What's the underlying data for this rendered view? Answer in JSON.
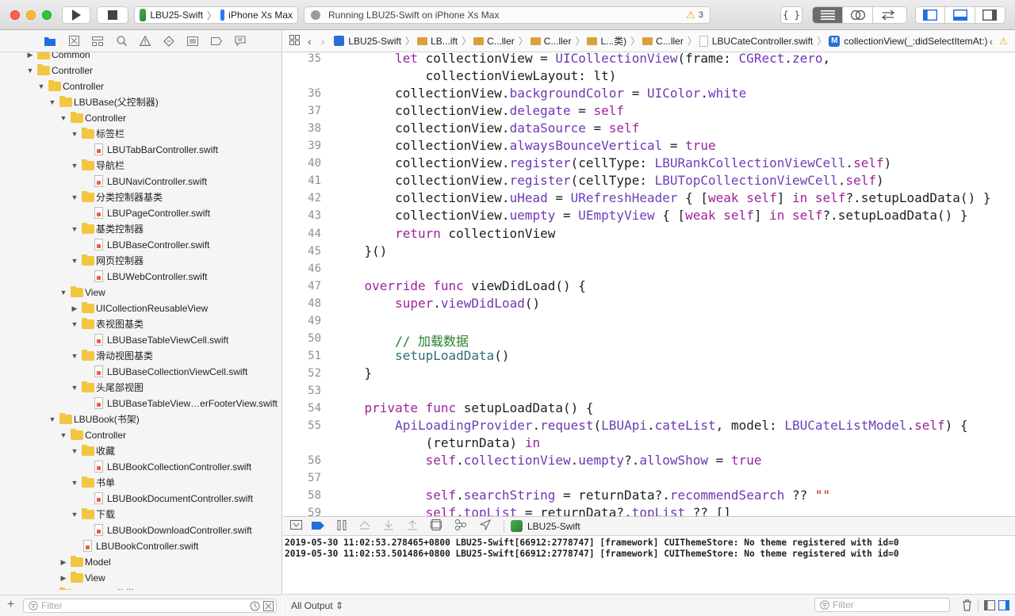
{
  "toolbar": {
    "scheme_target": "LBU25-Swift",
    "scheme_device": "iPhone Xs Max",
    "status_text": "Running LBU25-Swift on iPhone Xs Max",
    "warning_count": "3"
  },
  "navigator": {
    "items": [
      {
        "depth": 2,
        "type": "folder",
        "open": false,
        "label": "Common"
      },
      {
        "depth": 2,
        "type": "folder",
        "open": true,
        "label": "Controller"
      },
      {
        "depth": 3,
        "type": "folder",
        "open": true,
        "label": "Controller"
      },
      {
        "depth": 4,
        "type": "folder",
        "open": true,
        "label": "LBUBase(父控制器)"
      },
      {
        "depth": 5,
        "type": "folder",
        "open": true,
        "label": "Controller"
      },
      {
        "depth": 6,
        "type": "folder",
        "open": true,
        "label": "标签栏"
      },
      {
        "depth": 7,
        "type": "file",
        "label": "LBUTabBarController.swift"
      },
      {
        "depth": 6,
        "type": "folder",
        "open": true,
        "label": "导航栏"
      },
      {
        "depth": 7,
        "type": "file",
        "label": "LBUNaviController.swift"
      },
      {
        "depth": 6,
        "type": "folder",
        "open": true,
        "label": "分类控制器基类"
      },
      {
        "depth": 7,
        "type": "file",
        "label": "LBUPageController.swift"
      },
      {
        "depth": 6,
        "type": "folder",
        "open": true,
        "label": "基类控制器"
      },
      {
        "depth": 7,
        "type": "file",
        "label": "LBUBaseController.swift"
      },
      {
        "depth": 6,
        "type": "folder",
        "open": true,
        "label": "网页控制器"
      },
      {
        "depth": 7,
        "type": "file",
        "label": "LBUWebController.swift"
      },
      {
        "depth": 5,
        "type": "folder",
        "open": true,
        "label": "View"
      },
      {
        "depth": 6,
        "type": "folder",
        "open": false,
        "label": "UICollectionReusableView"
      },
      {
        "depth": 6,
        "type": "folder",
        "open": true,
        "label": "表视图基类"
      },
      {
        "depth": 7,
        "type": "file",
        "label": "LBUBaseTableViewCell.swift"
      },
      {
        "depth": 6,
        "type": "folder",
        "open": true,
        "label": "滑动视图基类"
      },
      {
        "depth": 7,
        "type": "file",
        "label": "LBUBaseCollectionViewCell.swift"
      },
      {
        "depth": 6,
        "type": "folder",
        "open": true,
        "label": "头尾部视图"
      },
      {
        "depth": 7,
        "type": "file",
        "label": "LBUBaseTableView…erFooterView.swift"
      },
      {
        "depth": 4,
        "type": "folder",
        "open": true,
        "label": "LBUBook(书架)"
      },
      {
        "depth": 5,
        "type": "folder",
        "open": true,
        "label": "Controller"
      },
      {
        "depth": 6,
        "type": "folder",
        "open": true,
        "label": "收藏"
      },
      {
        "depth": 7,
        "type": "file",
        "label": "LBUBookCollectionController.swift"
      },
      {
        "depth": 6,
        "type": "folder",
        "open": true,
        "label": "书单"
      },
      {
        "depth": 7,
        "type": "file",
        "label": "LBUBookDocumentController.swift"
      },
      {
        "depth": 6,
        "type": "folder",
        "open": true,
        "label": "下载"
      },
      {
        "depth": 7,
        "type": "file",
        "label": "LBUBookDownloadController.swift"
      },
      {
        "depth": 6,
        "type": "file",
        "label": "LBUBookController.swift"
      },
      {
        "depth": 5,
        "type": "folder",
        "open": false,
        "label": "Model"
      },
      {
        "depth": 5,
        "type": "folder",
        "open": false,
        "label": "View"
      },
      {
        "depth": 4,
        "type": "folder",
        "open": true,
        "label": "LBUCate(分类)"
      }
    ],
    "filter_placeholder": "Filter"
  },
  "jumpbar": {
    "crumbs": [
      "LBU25-Swift",
      "LB...ift",
      "C...ller",
      "C...ller",
      "L...类)",
      "C...ller",
      "LBUCateController.swift",
      "collectionView(_:didSelectItemAt:)"
    ]
  },
  "editor": {
    "lines": [
      {
        "n": "35",
        "html": "    <span class=\"kw\">let</span> collectionView = <span class=\"ty\">UICollectionView</span>(frame: <span class=\"ty\">CGRect</span>.<span class=\"pr\">zero</span>,"
      },
      {
        "n": "",
        "html": "        collectionViewLayout: lt)"
      },
      {
        "n": "36",
        "html": "    collectionView.<span class=\"pr\">backgroundColor</span> = <span class=\"ty\">UIColor</span>.<span class=\"pr\">white</span>"
      },
      {
        "n": "37",
        "html": "    collectionView.<span class=\"pr\">delegate</span> = <span class=\"kw\">self</span>"
      },
      {
        "n": "38",
        "html": "    collectionView.<span class=\"pr\">dataSource</span> = <span class=\"kw\">self</span>"
      },
      {
        "n": "39",
        "html": "    collectionView.<span class=\"pr\">alwaysBounceVertical</span> = <span class=\"kw\">true</span>"
      },
      {
        "n": "40",
        "html": "    collectionView.<span class=\"pr\">register</span>(cellType: <span class=\"cls\">LBURankCollectionViewCell</span>.<span class=\"kw\">self</span>)"
      },
      {
        "n": "41",
        "html": "    collectionView.<span class=\"pr\">register</span>(cellType: <span class=\"cls\">LBUTopCollectionViewCell</span>.<span class=\"kw\">self</span>)"
      },
      {
        "n": "42",
        "html": "    collectionView.<span class=\"pr\">uHead</span> = <span class=\"cls\">URefreshHeader</span> { [<span class=\"kw\">weak</span> <span class=\"kw\">self</span>] <span class=\"kw\">in</span> <span class=\"kw\">self</span>?.setupLoadData() }"
      },
      {
        "n": "43",
        "html": "    collectionView.<span class=\"pr\">uempty</span> = <span class=\"cls\">UEmptyView</span> { [<span class=\"kw\">weak</span> <span class=\"kw\">self</span>] <span class=\"kw\">in</span> <span class=\"kw\">self</span>?.setupLoadData() }"
      },
      {
        "n": "44",
        "html": "    <span class=\"kw\">return</span> collectionView"
      },
      {
        "n": "45",
        "html": "}()"
      },
      {
        "n": "46",
        "html": ""
      },
      {
        "n": "47",
        "html": "<span class=\"kw\">override</span> <span class=\"kw\">func</span> viewDidLoad() {"
      },
      {
        "n": "48",
        "html": "    <span class=\"kw\">super</span>.<span class=\"pr\">viewDidLoad</span>()"
      },
      {
        "n": "49",
        "html": ""
      },
      {
        "n": "50",
        "html": "    <span class=\"cm\">// 加载数据</span>"
      },
      {
        "n": "51",
        "html": "    <span class=\"fn\">setupLoadData</span>()"
      },
      {
        "n": "52",
        "html": "}"
      },
      {
        "n": "53",
        "html": ""
      },
      {
        "n": "54",
        "html": "<span class=\"kw\">private</span> <span class=\"kw\">func</span> setupLoadData() {"
      },
      {
        "n": "55",
        "html": "    <span class=\"cls\">ApiLoadingProvider</span>.<span class=\"pr\">request</span>(<span class=\"cls\">LBUApi</span>.<span class=\"pr\">cateList</span>, model: <span class=\"cls\">LBUCateListModel</span>.<span class=\"kw\">self</span>) {"
      },
      {
        "n": "",
        "html": "        (returnData) <span class=\"kw\">in</span>"
      },
      {
        "n": "56",
        "html": "        <span class=\"kw\">self</span>.<span class=\"pr\">collectionView</span>.<span class=\"pr\">uempty</span>?.<span class=\"pr\">allowShow</span> = <span class=\"kw\">true</span>"
      },
      {
        "n": "57",
        "html": ""
      },
      {
        "n": "58",
        "html": "        <span class=\"kw\">self</span>.<span class=\"pr\">searchString</span> = returnData?.<span class=\"pr\">recommendSearch</span> ?? <span class=\"st\">\"\"</span>"
      },
      {
        "n": "59",
        "html": "        <span class=\"kw\">self</span>.<span class=\"pr\">topList</span> = returnData?.<span class=\"pr\">topList</span> ?? []"
      }
    ]
  },
  "debug": {
    "target": "LBU25-Swift"
  },
  "console": {
    "lines": [
      "2019-05-30 11:02:53.278465+0800 LBU25-Swift[66912:2778747] [framework] CUIThemeStore: No theme registered with id=0",
      "2019-05-30 11:02:53.501486+0800 LBU25-Swift[66912:2778747] [framework] CUIThemeStore: No theme registered with id=0"
    ],
    "output_selector": "All Output ⇕",
    "filter_placeholder": "Filter"
  }
}
